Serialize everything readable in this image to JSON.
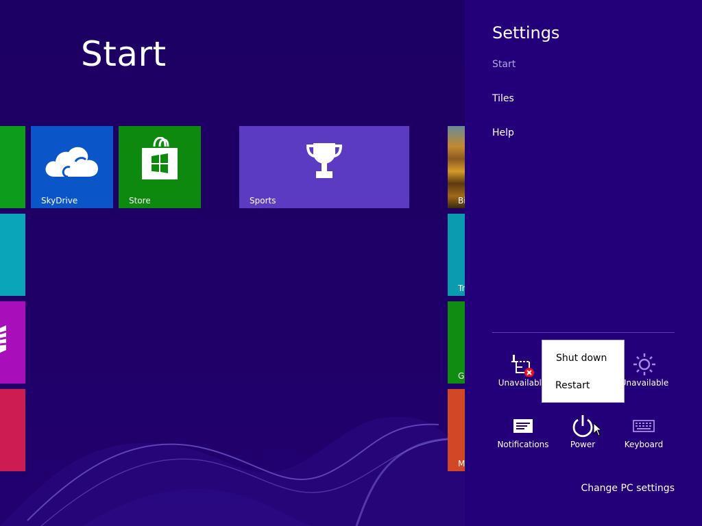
{
  "start": {
    "title": "Start",
    "tiles": {
      "skydrive": {
        "label": "SkyDrive",
        "color": "#0a56c8",
        "icon": "cloud-icon"
      },
      "store": {
        "label": "Store",
        "color": "#0d8a0d",
        "icon": "shopping-bag-icon"
      },
      "sports": {
        "label": "Sports",
        "color": "#5b3bc2",
        "icon": "trophy-icon"
      },
      "bing": {
        "label": "Bi",
        "icon": "landscape-image"
      },
      "travel": {
        "label": "Tr",
        "color": "#0a9bb0"
      },
      "games": {
        "label": "G",
        "color": "#108c10"
      },
      "music": {
        "label": "M",
        "color": "#d24726"
      }
    },
    "left_tile_colors": [
      "#0d9d1a",
      "#0aa5b8",
      "#a80fba",
      "#cc1c52"
    ]
  },
  "settings": {
    "title": "Settings",
    "links": [
      "Start",
      "Tiles",
      "Help"
    ],
    "quick_settings": [
      {
        "label": "Unavailable",
        "icon": "network-unavailable-icon"
      },
      {
        "label": "Unavailable",
        "icon": "brightness-icon"
      },
      {
        "label": "Notifications",
        "icon": "notifications-icon"
      },
      {
        "label": "Power",
        "icon": "power-icon"
      },
      {
        "label": "Keyboard",
        "icon": "keyboard-icon"
      }
    ],
    "change_pc_settings": "Change PC settings"
  },
  "power_menu": {
    "items": [
      "Shut down",
      "Restart"
    ]
  },
  "colors": {
    "start_background": "#1f0066",
    "charm_background": "#23007a",
    "accent": "#5b3bc2"
  }
}
